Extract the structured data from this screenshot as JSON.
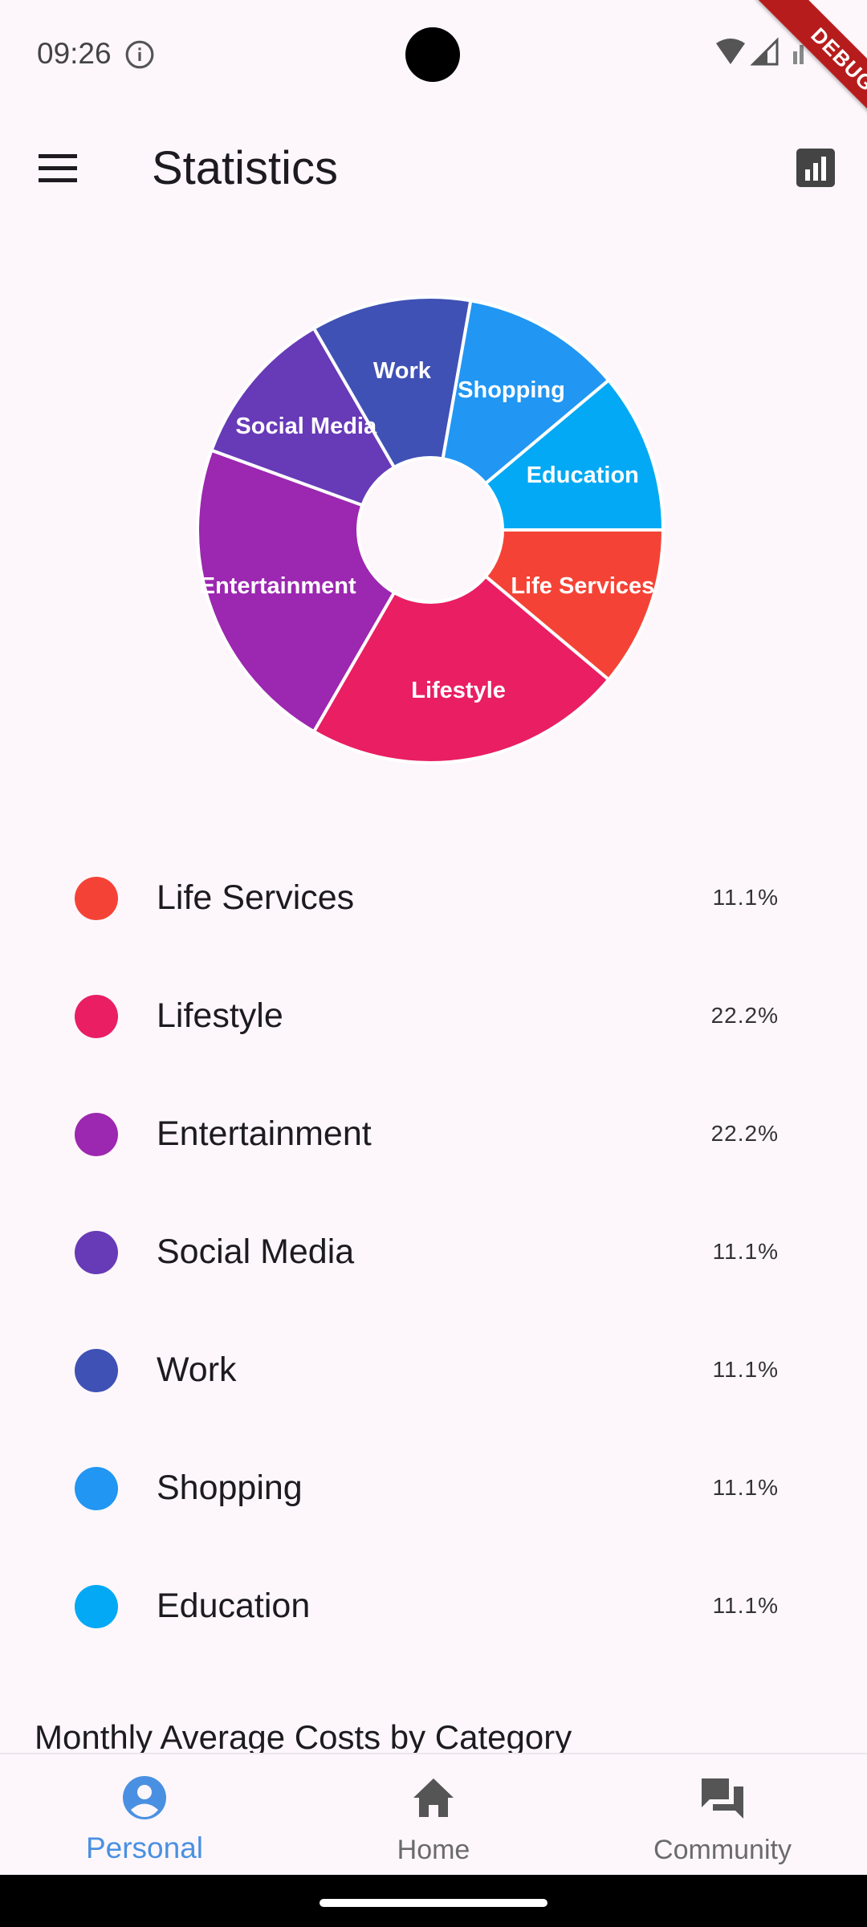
{
  "status": {
    "time": "09:26"
  },
  "debug": {
    "label": "DEBUG"
  },
  "app_bar": {
    "title": "Statistics"
  },
  "categories": [
    {
      "label": "Life Services",
      "percent": "11.1%",
      "value": 11.1,
      "color": "#f44336"
    },
    {
      "label": "Lifestyle",
      "percent": "22.2%",
      "value": 22.2,
      "color": "#e91e63"
    },
    {
      "label": "Entertainment",
      "percent": "22.2%",
      "value": 22.2,
      "color": "#9c27b0"
    },
    {
      "label": "Social Media",
      "percent": "11.1%",
      "value": 11.1,
      "color": "#673ab7"
    },
    {
      "label": "Work",
      "percent": "11.1%",
      "value": 11.1,
      "color": "#3f51b5"
    },
    {
      "label": "Shopping",
      "percent": "11.1%",
      "value": 11.1,
      "color": "#2196f3"
    },
    {
      "label": "Education",
      "percent": "11.1%",
      "value": 11.1,
      "color": "#03a9f4"
    }
  ],
  "section": {
    "title": "Monthly Average Costs by Category"
  },
  "nav": {
    "items": [
      {
        "label": "Personal",
        "icon": "person-icon",
        "active": true
      },
      {
        "label": "Home",
        "icon": "home-icon",
        "active": false
      },
      {
        "label": "Community",
        "icon": "forum-icon",
        "active": false
      }
    ]
  },
  "colors": {
    "accent": "#4a90e2",
    "background": "#fdf7fb"
  }
}
